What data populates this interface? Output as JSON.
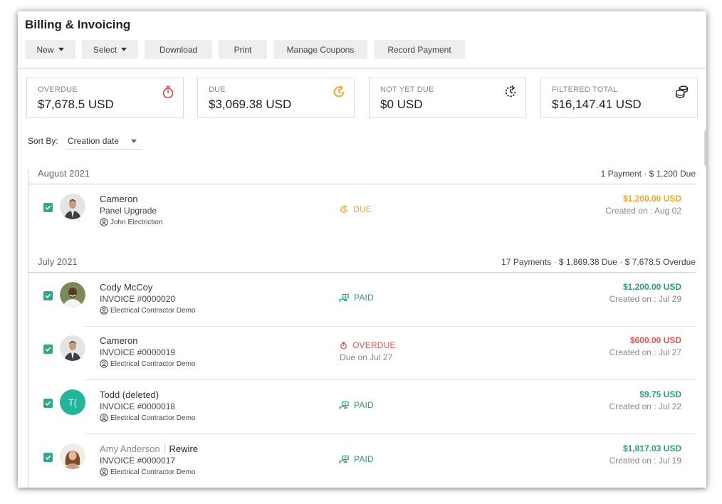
{
  "colors": {
    "due": "#f5a623",
    "overdue": "#e8534a",
    "paid": "#26a17f",
    "checkbox": "#2fa88b",
    "avatar_initials_bg": "#22b59b"
  },
  "page": {
    "title": "Billing & Invoicing"
  },
  "toolbar": {
    "new_label": "New",
    "select_label": "Select",
    "download_label": "Download",
    "print_label": "Print",
    "manage_coupons_label": "Manage Coupons",
    "record_payment_label": "Record Payment"
  },
  "summary": {
    "overdue": {
      "label": "OVERDUE",
      "value": "$7,678.5 USD",
      "icon": "stopwatch-icon"
    },
    "due": {
      "label": "DUE",
      "value": "$3,069.38 USD",
      "icon": "clock-refresh-icon"
    },
    "not_yet_due": {
      "label": "NOT YET DUE",
      "value": "$0 USD",
      "icon": "clock-dashed-icon"
    },
    "filtered_total": {
      "label": "FILTERED TOTAL",
      "value": "$16,147.41 USD",
      "icon": "coins-stack-icon"
    }
  },
  "sort": {
    "label": "Sort By:",
    "selected": "Creation date"
  },
  "groups": [
    {
      "title": "August 2021",
      "summary": "1 Payment   ·  $ 1,200 Due",
      "rows": [
        {
          "name": "Cameron",
          "sub": "Panel Upgrade",
          "company": "John Electriction",
          "status": "DUE",
          "status_sub": "",
          "amount": "$1,200.00 USD",
          "created": "Created on : Aug 02",
          "avatar": "photo-man-suit"
        }
      ]
    },
    {
      "title": "July 2021",
      "summary": "17 Payments   ·  $ 1,869.38 Due   ·  $ 7,678.5 Overdue",
      "rows": [
        {
          "name": "Cody McCoy",
          "sub": "INVOICE #0000020",
          "company": "Electrical Contractor Demo",
          "status": "PAID",
          "status_sub": "",
          "amount": "$1,200.00 USD",
          "created": "Created on : Jul 29",
          "avatar": "photo-man-smiling"
        },
        {
          "name": "Cameron",
          "sub": "INVOICE #0000019",
          "company": "Electrical Contractor Demo",
          "status": "OVERDUE",
          "status_sub": "Due on Jul 27",
          "amount": "$600.00 USD",
          "created": "Created on : Jul 27",
          "avatar": "photo-man-suit"
        },
        {
          "name": "Todd (deleted)",
          "sub": "INVOICE #0000018",
          "company": "Electrical Contractor Demo",
          "status": "PAID",
          "status_sub": "",
          "amount": "$9.75 USD",
          "created": "Created on : Jul 22",
          "avatar": "T("
        },
        {
          "name": "Amy Anderson",
          "tag": "Rewire",
          "sub": "INVOICE #0000017",
          "company": "Electrical Contractor Demo",
          "status": "PAID",
          "status_sub": "",
          "amount": "$1,817.03 USD",
          "created": "Created on : Jul 19",
          "avatar": "photo-woman"
        }
      ]
    }
  ]
}
